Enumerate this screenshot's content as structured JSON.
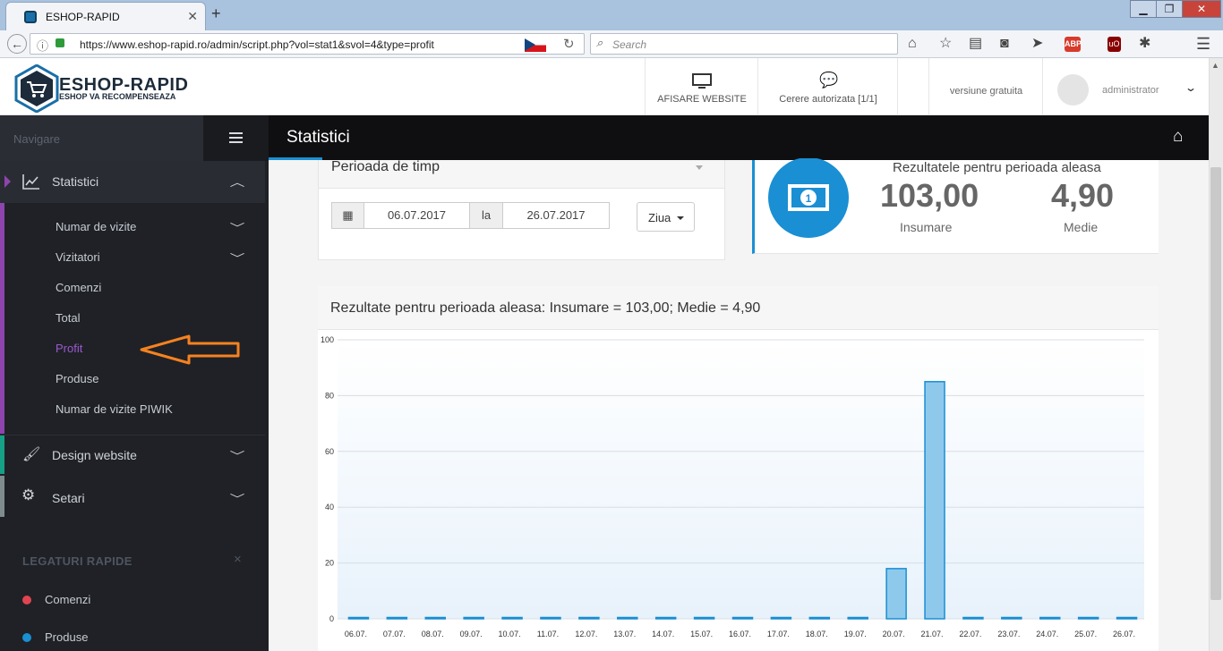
{
  "browser": {
    "tab_title": "ESHOP-RAPID",
    "url": "https://www.eshop-rapid.ro/admin/script.php?vol=stat1&svol=4&type=profit",
    "search_placeholder": "Search"
  },
  "header": {
    "logo_title": "ESHOP-RAPID",
    "logo_subtitle": "ESHOP VA RECOMPENSEAZA",
    "website_button": "AFISARE WEBSITE",
    "requests_button": "Cerere autorizata [1/1]",
    "version_text": "versiune gratuita",
    "user_name": "administrator"
  },
  "sidebar": {
    "nav_label": "Navigare",
    "statistici": "Statistici",
    "sub_items": [
      "Numar de vizite",
      "Vizitatori",
      "Comenzi",
      "Total",
      "Profit",
      "Produse",
      "Numar de vizite PIWIK"
    ],
    "active_item": "Profit",
    "design": "Design website",
    "setari": "Setari",
    "quick_links_title": "LEGATURI RAPIDE",
    "quick_links_close": "×",
    "quick_links": [
      {
        "label": "Comenzi",
        "color": "#e0454f"
      },
      {
        "label": "Produse",
        "color": "#1a8fd3"
      }
    ]
  },
  "main": {
    "page_title": "Statistici",
    "period_title": "Perioada de timp",
    "date_from": "06.07.2017",
    "date_sep": "la",
    "date_to": "26.07.2017",
    "granularity": "Ziua",
    "results_title": "Rezultatele pentru perioada aleasa",
    "sum_value": "103,00",
    "sum_label": "Insumare",
    "avg_value": "4,90",
    "avg_label": "Medie",
    "chart_header": "Rezultate pentru perioada aleasa: Insumare = 103,00; Medie = 4,90"
  },
  "colors": {
    "accent": "#1a8fd3",
    "active_purple": "#8e44ad",
    "sidebar_bg": "#1f2126",
    "arrow": "#f58220"
  },
  "chart_data": {
    "type": "bar",
    "categories": [
      "06.07.",
      "07.07.",
      "08.07.",
      "09.07.",
      "10.07.",
      "11.07.",
      "12.07.",
      "13.07.",
      "14.07.",
      "15.07.",
      "16.07.",
      "17.07.",
      "18.07.",
      "19.07.",
      "20.07.",
      "21.07.",
      "22.07.",
      "23.07.",
      "24.07.",
      "25.07.",
      "26.07."
    ],
    "values": [
      0,
      0,
      0,
      0,
      0,
      0,
      0,
      0,
      0,
      0,
      0,
      0,
      0,
      0,
      18,
      85,
      0,
      0,
      0,
      0,
      0
    ],
    "yticks": [
      0,
      20,
      40,
      60,
      80,
      100
    ],
    "ylim": [
      0,
      100
    ],
    "grid": true
  }
}
